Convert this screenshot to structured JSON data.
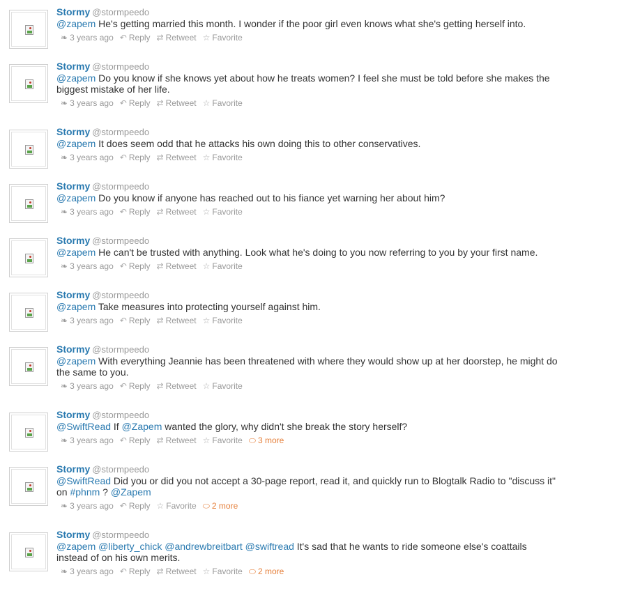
{
  "action_labels": {
    "reply": "Reply",
    "retweet": "Retweet",
    "favorite": "Favorite"
  },
  "tweets": [
    {
      "fullname": "Stormy",
      "username": "@stormpeedo",
      "text": [
        {
          "t": "@zapem",
          "m": true
        },
        {
          "t": " He's getting married this month. I wonder if the poor girl even knows what she's getting herself into.",
          "m": false
        }
      ],
      "timestamp": "3 years ago",
      "show_retweet": true,
      "more": ""
    },
    {
      "fullname": "Stormy",
      "username": "@stormpeedo",
      "text": [
        {
          "t": "@zapem",
          "m": true
        },
        {
          "t": " Do you know if she knows yet about how he treats women? I feel she must be told before she makes the biggest mistake of her life.",
          "m": false
        }
      ],
      "timestamp": "3 years ago",
      "show_retweet": true,
      "more": ""
    },
    {
      "fullname": "Stormy",
      "username": "@stormpeedo",
      "text": [
        {
          "t": "@zapem",
          "m": true
        },
        {
          "t": " It does seem odd that he attacks his own doing this to other conservatives.",
          "m": false
        }
      ],
      "timestamp": "3 years ago",
      "show_retweet": true,
      "more": ""
    },
    {
      "fullname": "Stormy",
      "username": "@stormpeedo",
      "text": [
        {
          "t": "@zapem",
          "m": true
        },
        {
          "t": " Do you know if anyone has reached out to his fiance yet warning her about him?",
          "m": false
        }
      ],
      "timestamp": "3 years ago",
      "show_retweet": true,
      "more": ""
    },
    {
      "fullname": "Stormy",
      "username": "@stormpeedo",
      "text": [
        {
          "t": "@zapem",
          "m": true
        },
        {
          "t": " He can't be trusted with anything. Look what he's doing to you now referring to you by your first name.",
          "m": false
        }
      ],
      "timestamp": "3 years ago",
      "show_retweet": true,
      "more": ""
    },
    {
      "fullname": "Stormy",
      "username": "@stormpeedo",
      "text": [
        {
          "t": "@zapem",
          "m": true
        },
        {
          "t": " Take measures into protecting yourself against him.",
          "m": false
        }
      ],
      "timestamp": "3 years ago",
      "show_retweet": true,
      "more": ""
    },
    {
      "fullname": "Stormy",
      "username": "@stormpeedo",
      "text": [
        {
          "t": "@zapem",
          "m": true
        },
        {
          "t": " With everything Jeannie has been threatened with where they would show up at her doorstep, he might do the same to you.",
          "m": false
        }
      ],
      "timestamp": "3 years ago",
      "show_retweet": true,
      "more": ""
    },
    {
      "fullname": "Stormy",
      "username": "@stormpeedo",
      "text": [
        {
          "t": "@SwiftRead",
          "m": true
        },
        {
          "t": " If ",
          "m": false
        },
        {
          "t": "@Zapem",
          "m": true
        },
        {
          "t": " wanted the glory, why didn't she break the story herself?",
          "m": false
        }
      ],
      "timestamp": "3 years ago",
      "show_retweet": true,
      "more": "3 more"
    },
    {
      "fullname": "Stormy",
      "username": "@stormpeedo",
      "text": [
        {
          "t": "@SwiftRead",
          "m": true
        },
        {
          "t": " Did you or did you not accept a 30-page report, read it, and quickly run to Blogtalk Radio to \"discuss it\" on ",
          "m": false
        },
        {
          "t": "#phnm",
          "m": true
        },
        {
          "t": " ? ",
          "m": false
        },
        {
          "t": "@Zapem",
          "m": true
        }
      ],
      "timestamp": "3 years ago",
      "show_retweet": false,
      "more": "2 more"
    },
    {
      "fullname": "Stormy",
      "username": "@stormpeedo",
      "text": [
        {
          "t": "@zapem",
          "m": true
        },
        {
          "t": " ",
          "m": false
        },
        {
          "t": "@liberty_chick",
          "m": true
        },
        {
          "t": " ",
          "m": false
        },
        {
          "t": "@andrewbreitbart",
          "m": true
        },
        {
          "t": " ",
          "m": false
        },
        {
          "t": "@swiftread",
          "m": true
        },
        {
          "t": " It's sad that he wants to ride someone else's coattails instead of on his own merits.",
          "m": false
        }
      ],
      "timestamp": "3 years ago",
      "show_retweet": true,
      "more": "2 more"
    }
  ]
}
